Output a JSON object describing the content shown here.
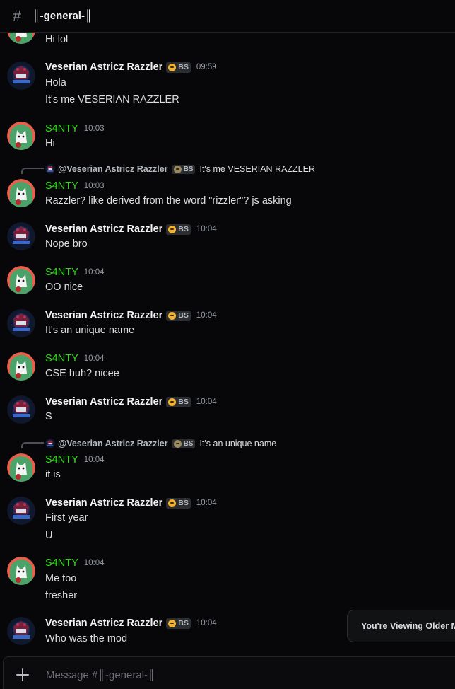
{
  "channel": {
    "title": "║-general-║",
    "hash_icon": "hash-icon"
  },
  "users": {
    "veserian": {
      "name": "Veserian Astricz Razzler",
      "tag": "BS",
      "avatar": "dark-blue-game-logo-avatar"
    },
    "santy": {
      "name": "S4NTY",
      "name_color": "#2ddc12",
      "avatar": "white-cat-orange-ring-avatar"
    }
  },
  "messages": [
    {
      "lines": [
        "Hi lol"
      ]
    },
    {
      "author": "Veserian Astricz Razzler",
      "tag": "BS",
      "time": "09:59",
      "lines": [
        "Hola",
        "It's me VESERIAN RAZZLER"
      ]
    },
    {
      "author": "S4NTY",
      "time": "10:03",
      "lines": [
        "Hi"
      ]
    },
    {
      "reply": {
        "to": "@Veserian Astricz Razzler",
        "tag": "BS",
        "text": "It's me VESERIAN RAZZLER"
      },
      "author": "S4NTY",
      "time": "10:03",
      "lines": [
        "Razzler? like derived from the word \"rizzler\"? js asking"
      ]
    },
    {
      "author": "Veserian Astricz Razzler",
      "tag": "BS",
      "time": "10:04",
      "lines": [
        "Nope bro"
      ]
    },
    {
      "author": "S4NTY",
      "time": "10:04",
      "lines": [
        "OO nice"
      ]
    },
    {
      "author": "Veserian Astricz Razzler",
      "tag": "BS",
      "time": "10:04",
      "lines": [
        "It's an unique name"
      ]
    },
    {
      "author": "S4NTY",
      "time": "10:04",
      "lines": [
        "CSE huh? nicee"
      ]
    },
    {
      "author": "Veserian Astricz Razzler",
      "tag": "BS",
      "time": "10:04",
      "lines": [
        "S"
      ]
    },
    {
      "reply": {
        "to": "@Veserian Astricz Razzler",
        "tag": "BS",
        "text": "It's an unique name"
      },
      "author": "S4NTY",
      "time": "10:04",
      "lines": [
        "it is"
      ]
    },
    {
      "author": "Veserian Astricz Razzler",
      "tag": "BS",
      "time": "10:04",
      "lines": [
        "First year",
        "U"
      ]
    },
    {
      "author": "S4NTY",
      "time": "10:04",
      "lines": [
        "Me too",
        "fresher"
      ]
    },
    {
      "author": "Veserian Astricz Razzler",
      "tag": "BS",
      "time": "10:04",
      "lines": [
        "Who was the mod"
      ]
    }
  ],
  "older_messages_notice": "You're Viewing Older Me",
  "composer": {
    "placeholder": "Message #║-general-║",
    "plus_icon": "plus-circle-icon"
  },
  "colors": {
    "background": "#070709",
    "accent_green": "#2ddc12",
    "tag_badge": "#f0b232"
  }
}
